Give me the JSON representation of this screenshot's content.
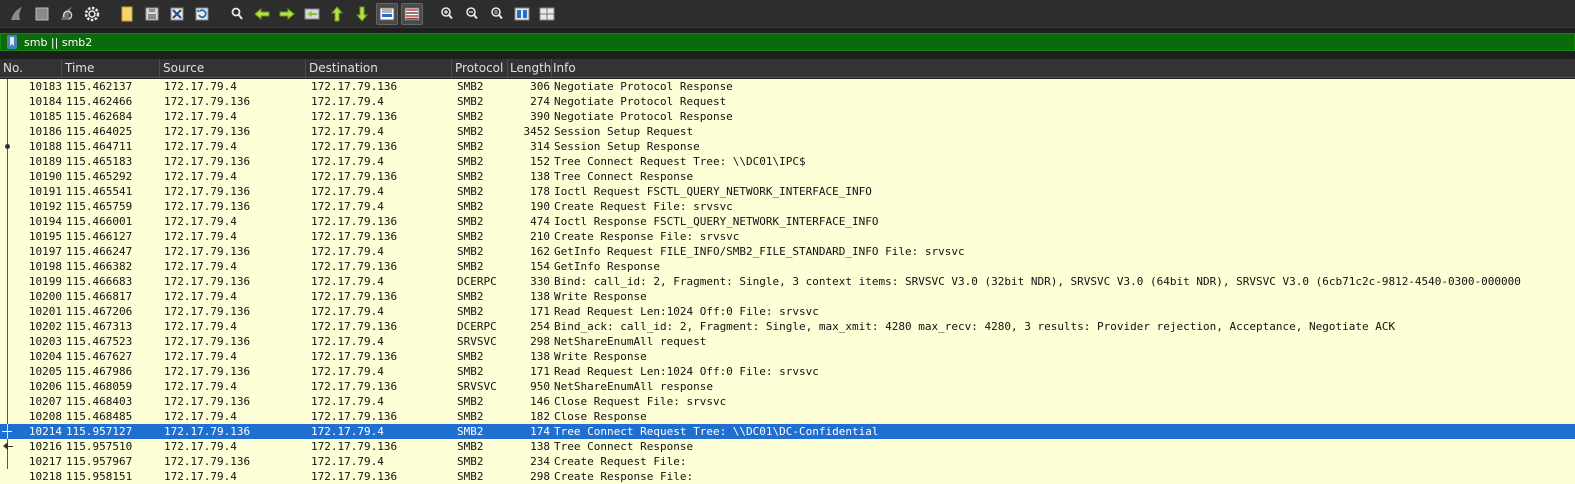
{
  "toolbar": {
    "icons": [
      "shark-fin-start-icon",
      "stop-square-icon",
      "shark-fin-restart-icon",
      "capture-options-gear-icon",
      "open-file-icon",
      "save-file-icon",
      "close-file-icon",
      "reload-file-icon",
      "find-packet-icon",
      "go-back-icon",
      "go-forward-icon",
      "go-to-packet-icon",
      "go-first-packet-icon",
      "go-last-packet-icon",
      "auto-scroll-icon",
      "colorize-icon",
      "zoom-in-icon",
      "zoom-out-icon",
      "zoom-normal-icon",
      "resize-columns-icon",
      "layout-icon"
    ]
  },
  "filter": {
    "value": "smb || smb2",
    "bg_color": "#0b6b0b"
  },
  "columns": {
    "no": "No.",
    "time": "Time",
    "source": "Source",
    "destination": "Destination",
    "protocol": "Protocol",
    "length": "Length",
    "info": "Info"
  },
  "colors": {
    "row_bg": "#ffffd7",
    "selected_bg": "#1f6fd1"
  },
  "packets": [
    {
      "no": "10183",
      "time": "115.462137",
      "src": "172.17.79.4",
      "dst": "172.17.79.136",
      "proto": "SMB2",
      "len": "306",
      "info": "Negotiate Protocol Response"
    },
    {
      "no": "10184",
      "time": "115.462466",
      "src": "172.17.79.136",
      "dst": "172.17.79.4",
      "proto": "SMB2",
      "len": "274",
      "info": "Negotiate Protocol Request"
    },
    {
      "no": "10185",
      "time": "115.462684",
      "src": "172.17.79.4",
      "dst": "172.17.79.136",
      "proto": "SMB2",
      "len": "390",
      "info": "Negotiate Protocol Response"
    },
    {
      "no": "10186",
      "time": "115.464025",
      "src": "172.17.79.136",
      "dst": "172.17.79.4",
      "proto": "SMB2",
      "len": "3452",
      "info": "Session Setup Request"
    },
    {
      "no": "10188",
      "time": "115.464711",
      "src": "172.17.79.4",
      "dst": "172.17.79.136",
      "proto": "SMB2",
      "len": "314",
      "info": "Session Setup Response"
    },
    {
      "no": "10189",
      "time": "115.465183",
      "src": "172.17.79.136",
      "dst": "172.17.79.4",
      "proto": "SMB2",
      "len": "152",
      "info": "Tree Connect Request Tree: \\\\DC01\\IPC$"
    },
    {
      "no": "10190",
      "time": "115.465292",
      "src": "172.17.79.4",
      "dst": "172.17.79.136",
      "proto": "SMB2",
      "len": "138",
      "info": "Tree Connect Response"
    },
    {
      "no": "10191",
      "time": "115.465541",
      "src": "172.17.79.136",
      "dst": "172.17.79.4",
      "proto": "SMB2",
      "len": "178",
      "info": "Ioctl Request FSCTL_QUERY_NETWORK_INTERFACE_INFO"
    },
    {
      "no": "10192",
      "time": "115.465759",
      "src": "172.17.79.136",
      "dst": "172.17.79.4",
      "proto": "SMB2",
      "len": "190",
      "info": "Create Request File: srvsvc"
    },
    {
      "no": "10194",
      "time": "115.466001",
      "src": "172.17.79.4",
      "dst": "172.17.79.136",
      "proto": "SMB2",
      "len": "474",
      "info": "Ioctl Response FSCTL_QUERY_NETWORK_INTERFACE_INFO"
    },
    {
      "no": "10195",
      "time": "115.466127",
      "src": "172.17.79.4",
      "dst": "172.17.79.136",
      "proto": "SMB2",
      "len": "210",
      "info": "Create Response File: srvsvc"
    },
    {
      "no": "10197",
      "time": "115.466247",
      "src": "172.17.79.136",
      "dst": "172.17.79.4",
      "proto": "SMB2",
      "len": "162",
      "info": "GetInfo Request FILE_INFO/SMB2_FILE_STANDARD_INFO File: srvsvc"
    },
    {
      "no": "10198",
      "time": "115.466382",
      "src": "172.17.79.4",
      "dst": "172.17.79.136",
      "proto": "SMB2",
      "len": "154",
      "info": "GetInfo Response"
    },
    {
      "no": "10199",
      "time": "115.466683",
      "src": "172.17.79.136",
      "dst": "172.17.79.4",
      "proto": "DCERPC",
      "len": "330",
      "info": "Bind: call_id: 2, Fragment: Single, 3 context items: SRVSVC V3.0 (32bit NDR), SRVSVC V3.0 (64bit NDR), SRVSVC V3.0 (6cb71c2c-9812-4540-0300-000000"
    },
    {
      "no": "10200",
      "time": "115.466817",
      "src": "172.17.79.4",
      "dst": "172.17.79.136",
      "proto": "SMB2",
      "len": "138",
      "info": "Write Response"
    },
    {
      "no": "10201",
      "time": "115.467206",
      "src": "172.17.79.136",
      "dst": "172.17.79.4",
      "proto": "SMB2",
      "len": "171",
      "info": "Read Request Len:1024 Off:0 File: srvsvc"
    },
    {
      "no": "10202",
      "time": "115.467313",
      "src": "172.17.79.4",
      "dst": "172.17.79.136",
      "proto": "DCERPC",
      "len": "254",
      "info": "Bind_ack: call_id: 2, Fragment: Single, max_xmit: 4280 max_recv: 4280, 3 results: Provider rejection, Acceptance, Negotiate ACK"
    },
    {
      "no": "10203",
      "time": "115.467523",
      "src": "172.17.79.136",
      "dst": "172.17.79.4",
      "proto": "SRVSVC",
      "len": "298",
      "info": "NetShareEnumAll request"
    },
    {
      "no": "10204",
      "time": "115.467627",
      "src": "172.17.79.4",
      "dst": "172.17.79.136",
      "proto": "SMB2",
      "len": "138",
      "info": "Write Response"
    },
    {
      "no": "10205",
      "time": "115.467986",
      "src": "172.17.79.136",
      "dst": "172.17.79.4",
      "proto": "SMB2",
      "len": "171",
      "info": "Read Request Len:1024 Off:0 File: srvsvc"
    },
    {
      "no": "10206",
      "time": "115.468059",
      "src": "172.17.79.4",
      "dst": "172.17.79.136",
      "proto": "SRVSVC",
      "len": "950",
      "info": "NetShareEnumAll response"
    },
    {
      "no": "10207",
      "time": "115.468403",
      "src": "172.17.79.136",
      "dst": "172.17.79.4",
      "proto": "SMB2",
      "len": "146",
      "info": "Close Request File: srvsvc"
    },
    {
      "no": "10208",
      "time": "115.468485",
      "src": "172.17.79.4",
      "dst": "172.17.79.136",
      "proto": "SMB2",
      "len": "182",
      "info": "Close Response"
    },
    {
      "no": "10214",
      "time": "115.957127",
      "src": "172.17.79.136",
      "dst": "172.17.79.4",
      "proto": "SMB2",
      "len": "174",
      "info": "Tree Connect Request Tree: \\\\DC01\\DC-Confidential",
      "selected": true
    },
    {
      "no": "10216",
      "time": "115.957510",
      "src": "172.17.79.4",
      "dst": "172.17.79.136",
      "proto": "SMB2",
      "len": "138",
      "info": "Tree Connect Response"
    },
    {
      "no": "10217",
      "time": "115.957967",
      "src": "172.17.79.136",
      "dst": "172.17.79.4",
      "proto": "SMB2",
      "len": "234",
      "info": "Create Request File:"
    },
    {
      "no": "10218",
      "time": "115.958151",
      "src": "172.17.79.4",
      "dst": "172.17.79.136",
      "proto": "SMB2",
      "len": "298",
      "info": "Create Response File:"
    }
  ]
}
